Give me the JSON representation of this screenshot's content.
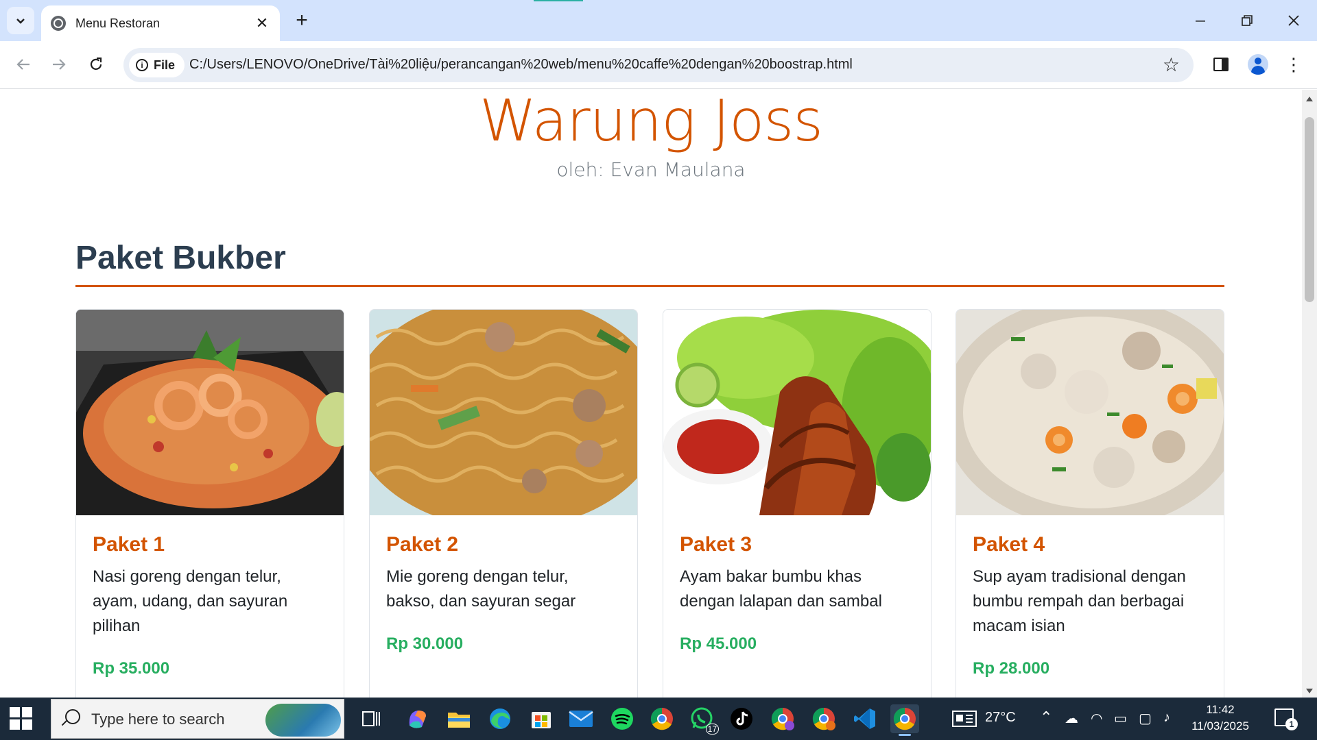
{
  "browser": {
    "tab_title": "Menu Restoran",
    "url_chip": "File",
    "url": "C:/Users/LENOVO/OneDrive/Tài%20liệu/perancangan%20web/menu%20caffe%20dengan%20boostrap.html",
    "icons": [
      "tab-search-icon",
      "globe-icon",
      "close-icon",
      "plus-icon",
      "minimize-icon",
      "restore-icon",
      "window-close-icon",
      "back-icon",
      "forward-icon",
      "reload-icon",
      "info-icon",
      "star-icon",
      "side-panel-icon",
      "profile-icon",
      "more-icon"
    ]
  },
  "page": {
    "title": "Warung Joss",
    "subtitle": "oleh: Evan Maulana",
    "section_title": "Paket Bukber",
    "accent_color": "#d35400",
    "price_color": "#27ae60",
    "cards": [
      {
        "title": "Paket 1",
        "description": "Nasi goreng dengan telur, ayam, udang, dan sayuran pilihan",
        "price": "Rp 35.000",
        "image": "fried-rice-shrimp-photo"
      },
      {
        "title": "Paket 2",
        "description": "Mie goreng dengan telur, bakso, dan sayuran segar",
        "price": "Rp 30.000",
        "image": "fried-noodles-meatball-photo"
      },
      {
        "title": "Paket 3",
        "description": "Ayam bakar bumbu khas dengan lalapan dan sambal",
        "price": "Rp 45.000",
        "image": "grilled-chicken-sambal-photo"
      },
      {
        "title": "Paket 4",
        "description": "Sup ayam tradisional dengan bumbu rempah dan berbagai macam isian",
        "price": "Rp 28.000",
        "image": "chicken-soup-photo"
      }
    ]
  },
  "taskbar": {
    "search_placeholder": "Type here to search",
    "whatsapp_badge": "17",
    "weather": "27°C",
    "time": "11:42",
    "date": "11/03/2025",
    "notification_count": "1"
  }
}
